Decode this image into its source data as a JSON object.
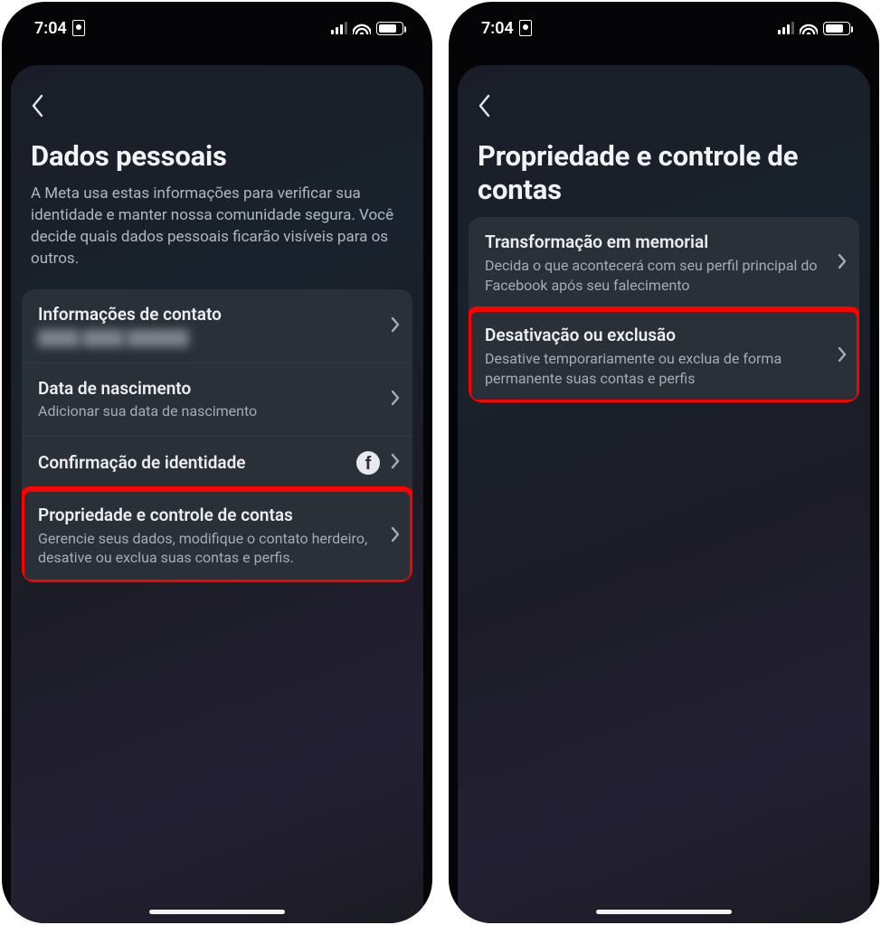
{
  "status": {
    "time": "7:04"
  },
  "screen1": {
    "title": "Dados pessoais",
    "description": "A Meta usa estas informações para verificar sua identidade e manter nossa comunidade segura. Você decide quais dados pessoais ficarão visíveis para os outros.",
    "rows": [
      {
        "title": "Informações de contato",
        "sub_hidden": true
      },
      {
        "title": "Data de nascimento",
        "sub": "Adicionar sua data de nascimento"
      },
      {
        "title": "Confirmação de identidade",
        "fb_badge": true
      },
      {
        "title": "Propriedade e controle de contas",
        "sub": "Gerencie seus dados, modifique o contato herdeiro, desative ou exclua suas contas e perfis.",
        "highlight": true
      }
    ]
  },
  "screen2": {
    "title": "Propriedade e controle de contas",
    "rows": [
      {
        "title": "Transformação em memorial",
        "sub": "Decida o que acontecerá com seu perfil principal do Facebook após seu falecimento"
      },
      {
        "title": "Desativação ou exclusão",
        "sub": "Desative temporariamente ou exclua de forma permanente suas contas e perfis",
        "highlight": true
      }
    ]
  }
}
